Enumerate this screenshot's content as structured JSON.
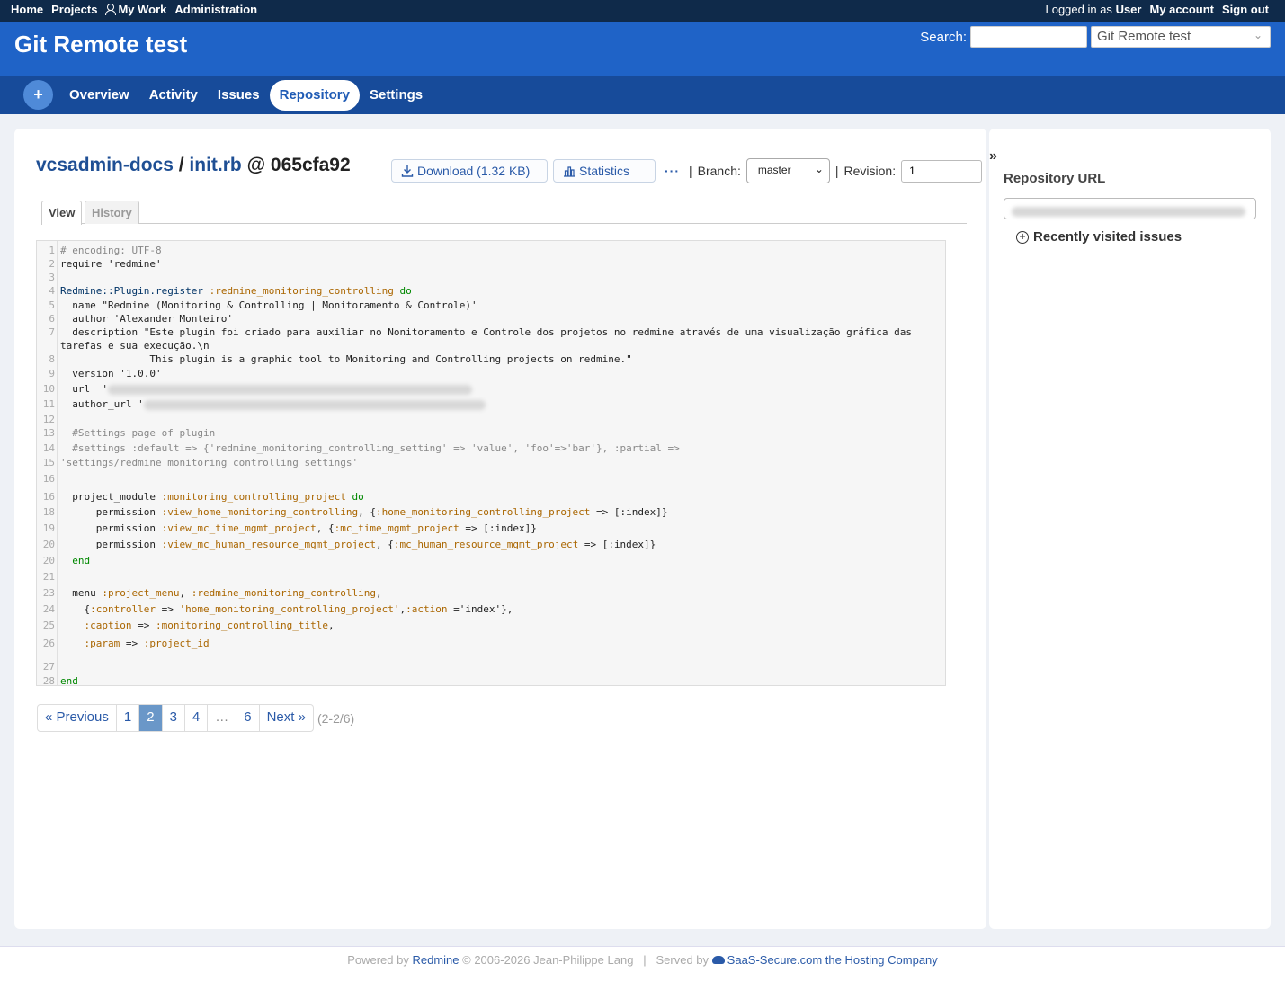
{
  "top_menu": {
    "left": [
      "Home",
      "Projects",
      "My Work",
      "Administration"
    ],
    "logged_in_prefix": "Logged in as",
    "user": "User",
    "my_account": "My account",
    "sign_out": "Sign out"
  },
  "header": {
    "title": "Git Remote test",
    "search_label": "Search:",
    "jump_value": "Git Remote test"
  },
  "main_menu": {
    "plus": "+",
    "tabs": [
      "Overview",
      "Activity",
      "Issues",
      "Repository",
      "Settings"
    ],
    "selected": "Repository"
  },
  "breadcrumb": {
    "repo": "vcsadmin-docs",
    "sep": "/",
    "file": "init.rb",
    "at": "@",
    "revision": "065cfa92"
  },
  "contextual": {
    "download": "Download (1.32 KB)",
    "statistics": "Statistics",
    "more": "···",
    "pipe": "|",
    "branch_label": "Branch:",
    "branch_value": "master",
    "revision_label": "Revision:",
    "revision_value": "1"
  },
  "tabs": {
    "view": "View",
    "history": "History"
  },
  "code": {
    "line_numbers": [
      "1",
      "2",
      "3",
      "4",
      "5",
      "6",
      "7",
      "8",
      "9",
      "10",
      "11",
      "12",
      "13",
      "14",
      "15",
      "16",
      "16",
      "18",
      "19",
      "20",
      "20",
      "21",
      "23",
      "24",
      "25",
      "26",
      "27",
      "28"
    ],
    "lines": [
      [
        [
          "cm",
          "# encoding: UTF-8"
        ]
      ],
      [
        [
          "",
          "require 'redmine'"
        ]
      ],
      [],
      [
        [
          "con",
          "Redmine::Plugin.register "
        ],
        [
          "sym",
          ":redmine_monitoring_controlling "
        ],
        [
          "kw",
          "do"
        ]
      ],
      [
        [
          "",
          "  name \"Redmine (Monitoring & Controlling | Monitoramento & Controle)'"
        ]
      ],
      [
        [
          "",
          "  author 'Alexander Monteiro'"
        ]
      ],
      [
        [
          "",
          "  description \"Este plugin foi criado para auxiliar no Nonitoramento e Controle dos projetos no redmine através de uma visualização gráfica das"
        ]
      ],
      [
        [
          "",
          "tarefas e sua execução.\\n"
        ]
      ],
      [
        [
          "",
          "               This plugin is a graphic tool to Monitoring and Controlling projects on redmine.\""
        ]
      ],
      [
        [
          "",
          "  version '1.0.0'"
        ]
      ],
      [
        [
          "",
          "  url  '"
        ]
      ],
      [
        [
          "",
          "  author_url '"
        ]
      ],
      [],
      [
        [
          "cm",
          "  #Settings page of plugin"
        ]
      ],
      [
        [
          "cm",
          "  #settings :default => {'redmine_monitoring_controlling_setting' => 'value', 'foo'=>'bar'}, :partial =>"
        ]
      ],
      [
        [
          "cm",
          "'settings/redmine_monitoring_controlling_settings'"
        ]
      ],
      [],
      [
        [
          "",
          "  project_module "
        ],
        [
          "sym",
          ":monitoring_controlling_project "
        ],
        [
          "kw",
          "do"
        ]
      ],
      [
        [
          "",
          "      permission "
        ],
        [
          "sym",
          ":view_home_monitoring_controlling"
        ],
        [
          "",
          ", {"
        ],
        [
          "sym",
          ":home_monitoring_controlling_project"
        ],
        [
          "",
          " => [:index]}"
        ]
      ],
      [
        [
          "",
          "      permission "
        ],
        [
          "sym",
          ":view_mc_time_mgmt_project"
        ],
        [
          "",
          ", {"
        ],
        [
          "sym",
          ":mc_time_mgmt_project"
        ],
        [
          "",
          " => [:index]}"
        ]
      ],
      [
        [
          "",
          "      permission "
        ],
        [
          "sym",
          ":view_mc_human_resource_mgmt_project"
        ],
        [
          "",
          ", {"
        ],
        [
          "sym",
          ":mc_human_resource_mgmt_project"
        ],
        [
          "",
          " => [:index]}"
        ]
      ],
      [
        [
          "kw",
          "  end"
        ]
      ],
      [],
      [
        [
          "",
          "  menu "
        ],
        [
          "sym",
          ":project_menu"
        ],
        [
          "",
          ", "
        ],
        [
          "sym",
          ":redmine_monitoring_controlling"
        ],
        [
          "",
          ","
        ]
      ],
      [
        [
          "",
          "    {"
        ],
        [
          "sym",
          ":controller"
        ],
        [
          "",
          " => "
        ],
        [
          "sym",
          "'home_monitoring_controlling_project'"
        ],
        [
          "",
          ","
        ],
        [
          "sym",
          ":action"
        ],
        [
          "",
          " ='index'},"
        ]
      ],
      [
        [
          "sym",
          "    :caption"
        ],
        [
          "",
          " => "
        ],
        [
          "sym",
          ":monitoring_controlling_title"
        ],
        [
          "",
          ","
        ]
      ],
      [
        [
          "sym",
          "    :param"
        ],
        [
          "",
          " => "
        ],
        [
          "sym",
          ":project_id"
        ]
      ],
      [],
      [
        [
          "kw",
          "end"
        ]
      ],
      []
    ]
  },
  "pagination": {
    "previous": "« Previous",
    "pages": [
      "1",
      "2",
      "3",
      "4",
      "…",
      "6"
    ],
    "current": "2",
    "next": "Next »",
    "count": "(2-2/6)"
  },
  "sidebar": {
    "toggle": "»",
    "repo_url_title": "Repository URL",
    "recent_title": "Recently visited issues"
  },
  "footer": {
    "powered_by": "Powered by",
    "redmine": "Redmine",
    "copyright": "© 2006-2026 Jean-Philippe Lang",
    "divider": "|",
    "served_by": "Served by",
    "host": "SaaS-Secure.com the Hosting Company"
  },
  "colors": {
    "top_bar": "#0f2a4a",
    "header": "#1f63c7",
    "main_menu": "#174b9a",
    "link": "#2a5aa8",
    "current_page": "#6a97c8"
  }
}
